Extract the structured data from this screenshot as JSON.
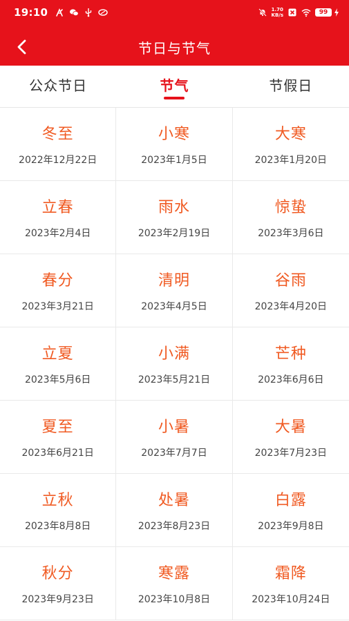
{
  "status_bar": {
    "time": "19:10",
    "net_speed_value": "1.70",
    "net_speed_unit": "KB/s",
    "battery": "99"
  },
  "header": {
    "title": "节日与节气"
  },
  "tabs": [
    {
      "label": "公众节日",
      "selected": false
    },
    {
      "label": "节气",
      "selected": true
    },
    {
      "label": "节假日",
      "selected": false
    }
  ],
  "terms": [
    {
      "name": "冬至",
      "date": "2022年12月22日"
    },
    {
      "name": "小寒",
      "date": "2023年1月5日"
    },
    {
      "name": "大寒",
      "date": "2023年1月20日"
    },
    {
      "name": "立春",
      "date": "2023年2月4日"
    },
    {
      "name": "雨水",
      "date": "2023年2月19日"
    },
    {
      "name": "惊蛰",
      "date": "2023年3月6日"
    },
    {
      "name": "春分",
      "date": "2023年3月21日"
    },
    {
      "name": "清明",
      "date": "2023年4月5日"
    },
    {
      "name": "谷雨",
      "date": "2023年4月20日"
    },
    {
      "name": "立夏",
      "date": "2023年5月6日"
    },
    {
      "name": "小满",
      "date": "2023年5月21日"
    },
    {
      "name": "芒种",
      "date": "2023年6月6日"
    },
    {
      "name": "夏至",
      "date": "2023年6月21日"
    },
    {
      "name": "小暑",
      "date": "2023年7月7日"
    },
    {
      "name": "大暑",
      "date": "2023年7月23日"
    },
    {
      "name": "立秋",
      "date": "2023年8月8日"
    },
    {
      "name": "处暑",
      "date": "2023年8月23日"
    },
    {
      "name": "白露",
      "date": "2023年9月8日"
    },
    {
      "name": "秋分",
      "date": "2023年9月23日"
    },
    {
      "name": "寒露",
      "date": "2023年10月8日"
    },
    {
      "name": "霜降",
      "date": "2023年10月24日"
    }
  ],
  "icons": {
    "back": "chevron-left-icon",
    "status_left": [
      "flame-icon",
      "wechat-icon",
      "usb-icon",
      "app-logo-icon"
    ],
    "status_right": [
      "do-not-disturb-icon",
      "sim-off-icon",
      "wifi-icon",
      "battery-icon",
      "charging-icon"
    ]
  },
  "colors": {
    "brand_red": "#e6121b",
    "term_name": "#f05a22",
    "date_text": "#444444",
    "tab_text": "#333333"
  }
}
